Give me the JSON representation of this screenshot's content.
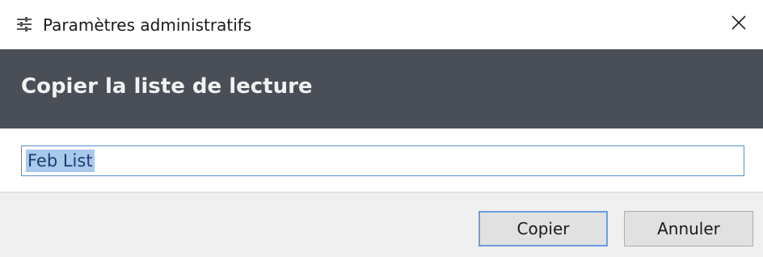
{
  "window": {
    "title": "Paramètres administratifs",
    "icons": {
      "app": "sliders-icon",
      "close": "close-icon"
    }
  },
  "dialog": {
    "heading": "Copier la liste de lecture",
    "name_field": {
      "value": "Feb List",
      "selected": true
    }
  },
  "buttons": {
    "copy_label": "Copier",
    "cancel_label": "Annuler"
  },
  "colors": {
    "header_bg": "#4a4f57",
    "footer_bg": "#f0f0f0",
    "focus_border": "#6d9be0",
    "selection": "#a9c9ec"
  }
}
